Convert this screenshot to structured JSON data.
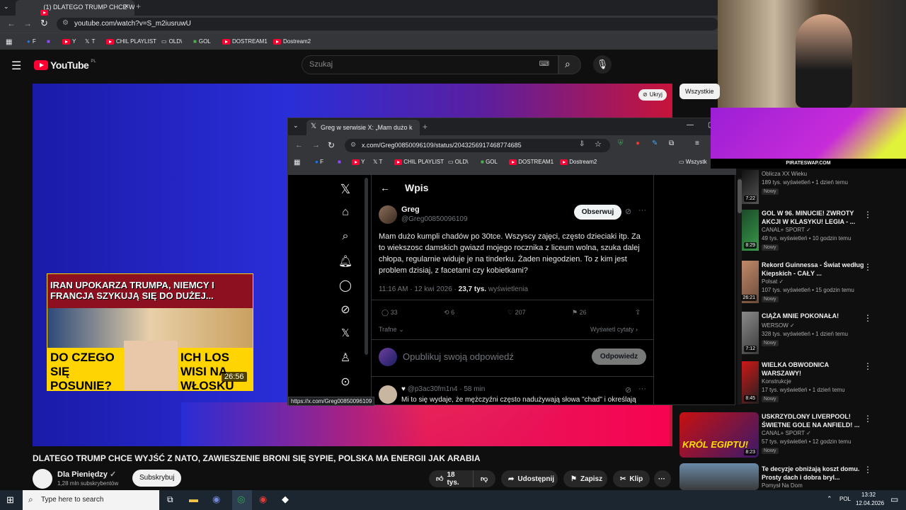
{
  "browser": {
    "tab_title": "(1) DLATEGO TRUMP CHCE WYJ...",
    "url": "youtube.com/watch?v=S_m2iusruwU",
    "bookmarks": [
      "F",
      "Y",
      "T",
      "CHIL PLAYLIST",
      "OLD\\",
      "GOL",
      "DOSTREAM1",
      "Dostream2"
    ]
  },
  "youtube": {
    "logo": "YouTube",
    "region": "PL",
    "search_placeholder": "Szukaj",
    "hide_label": "Ukryj",
    "filter_chip": "Wszystkie",
    "video_title": "DLATEGO TRUMP CHCE WYJŚĆ Z NATO, ZAWIESZENIE BRONI SIĘ SYPIE, POLSKA MA ENERGII JAK ARABIA",
    "channel": "Dla Pieniędzy",
    "subscribers": "1,28 mln subskrybentów",
    "subscribe": "Subskrybuj",
    "likes": "18 tys.",
    "share": "Udostępnij",
    "save": "Zapisz",
    "clip": "Klip"
  },
  "thumbnail": {
    "headline": "IRAN UPOKARZA TRUMPA, NIEMCY I FRANCJA SZYKUJĄ SIĘ DO DUŻEJ...",
    "left_caption": "DO CZEGO SIĘ POSUNIE?",
    "right_caption": "ICH LOS WISI NA WŁOSKU",
    "duration": "26:56"
  },
  "x_window": {
    "tab_title": "Greg w serwisie X: „Mam dużo k",
    "url": "x.com/Greg00850096109/status/2043256917468774685",
    "bookmarks": [
      "F",
      "Y",
      "T",
      "CHIL PLAYLIST",
      "OLD\\",
      "GOL",
      "DOSTREAM1",
      "Dostream2",
      "Wszystk"
    ],
    "header": "Wpis",
    "author_name": "Greg",
    "author_handle": "@Greg00850096109",
    "follow": "Obserwuj",
    "text": "Mam dużo kumpli chadów po 30tce. Wszyscy zajęci, często dzieciaki itp. Za to wiekszosc damskich gwiazd mojego rocznika z liceum wolna, szuka dalej chłopa, regularnie widuje je na tinderku. Żaden niegodzien. To z kim jest problem dzisiaj, z facetami czy kobietkami?",
    "time": "11:16 AM · 12 kwi 2026",
    "views_count": "23,7 tys.",
    "views_label": "wyświetlenia",
    "replies": "33",
    "reposts": "6",
    "likes": "207",
    "bookmarks_count": "26",
    "sort": "Trafne",
    "quotes": "Wyświetl cytaty",
    "reply_placeholder": "Opublikuj swoją odpowiedź",
    "reply_button": "Odpowiedz",
    "reply_handle": "@p3ac30fm1n4 · 58 min",
    "reply_text": "Mi to się wydaje, że mężczyźni często nadużywają słowa \"chad\" i określają",
    "status_url": "https://x.com/Greg00850096109"
  },
  "webcam_banner": "PIRATESWAP.COM",
  "related": [
    {
      "title": "Oblicza XX Wieku",
      "meta1": "189 tys. wyświetleń • 1 dzień temu",
      "badge": "Nowy",
      "duration": "7:22"
    },
    {
      "title": "GOL W 96. MINUCIE! ZWROTY AKCJI W KLASYKU! LEGIA - ...",
      "channel": "CANAL+ SPORT",
      "meta1": "49 tys. wyświetleń • 10 godzin temu",
      "badge": "Nowy",
      "duration": "8:29"
    },
    {
      "title": "Rekord Guinnessa - Świat według Kiepskich - CAŁY ...",
      "channel": "Polsat",
      "meta1": "107 tys. wyświetleń • 15 godzin temu",
      "badge": "Nowy",
      "duration": "26:21"
    },
    {
      "title": "CIĄŻA MNIE POKONAŁA!",
      "channel": "WERSOW",
      "meta1": "328 tys. wyświetleń • 1 dzień temu",
      "badge": "Nowy",
      "duration": "7:12"
    },
    {
      "title": "WIELKA OBWODNICA WARSZAWY!",
      "channel": "Konstrukcje",
      "meta1": "17 tys. wyświetleń • 1 dzień temu",
      "badge": "Nowy",
      "duration": "8:45"
    },
    {
      "title": "USKRZYDLONY LIVERPOOL! ŚWIETNE GOLE NA ANFIELD! ...",
      "channel": "CANAL+ SPORT",
      "meta1": "57 tys. wyświetleń • 12 godzin temu",
      "badge": "Nowy",
      "duration": "8:23",
      "thumb_text": "KRÓL EGIPTU!"
    },
    {
      "title": "Te decyzje obniżają koszt domu. Prosty dach i dobra bryl...",
      "channel": "Pomysł Na Dom"
    }
  ],
  "taskbar": {
    "search": "Type here to search",
    "lang": "POL",
    "time": "13:32",
    "date": "12.04.2026"
  }
}
